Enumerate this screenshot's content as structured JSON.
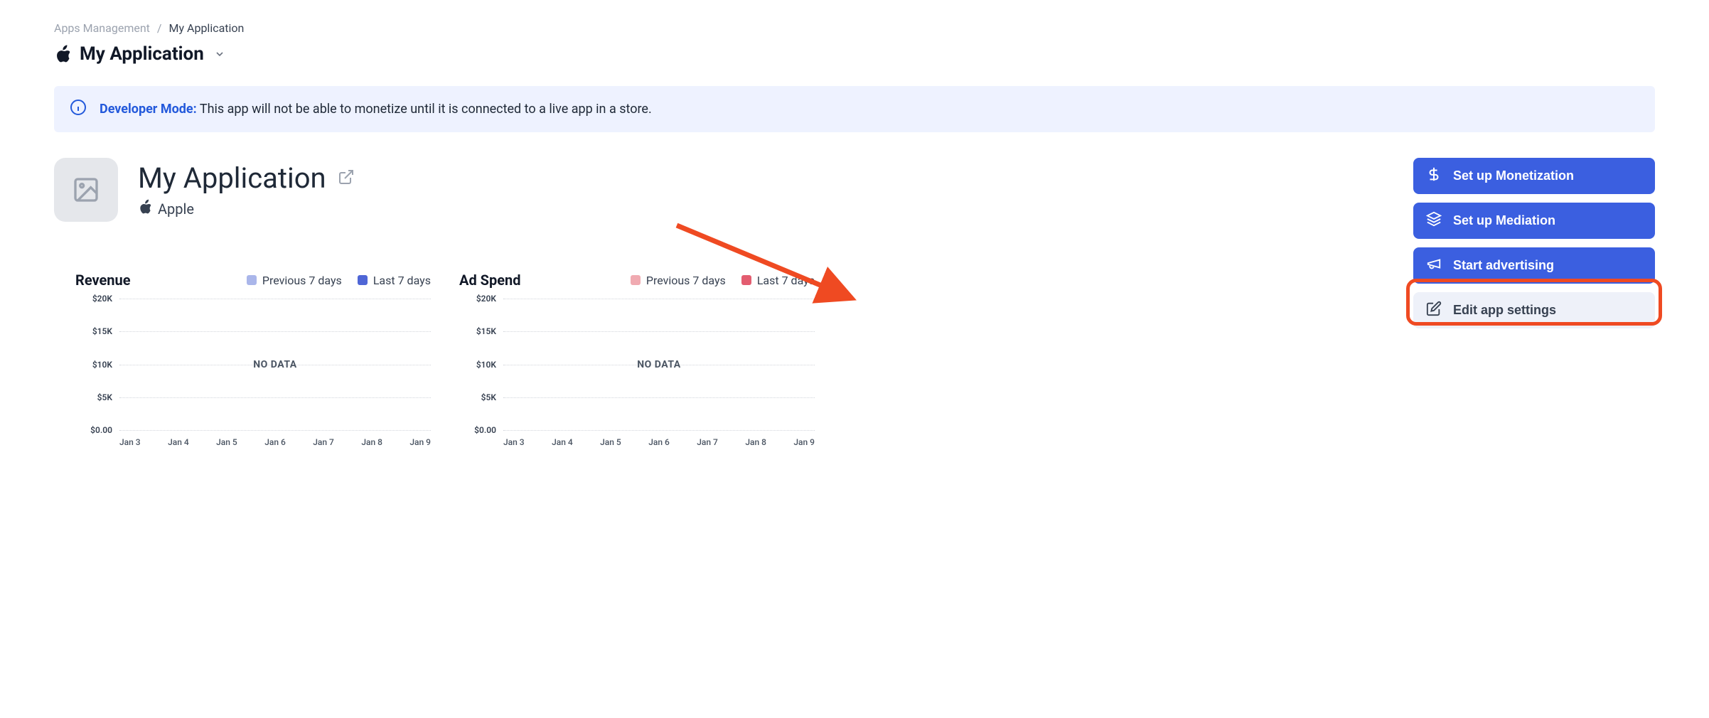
{
  "breadcrumb": {
    "root": "Apps Management",
    "current": "My Application"
  },
  "selector": {
    "app_name": "My Application"
  },
  "banner": {
    "lead": "Developer Mode:",
    "text": "This app will not be able to monetize until it is connected to a live app in a store."
  },
  "app": {
    "title": "My Application",
    "platform": "Apple"
  },
  "actions": {
    "monetization": "Set up Monetization",
    "mediation": "Set up Mediation",
    "advertising": "Start advertising",
    "edit_settings": "Edit app settings"
  },
  "legend": {
    "previous": "Previous 7 days",
    "last": "Last 7 days"
  },
  "charts": {
    "revenue": {
      "title": "Revenue",
      "no_data": "NO DATA"
    },
    "adspend": {
      "title": "Ad Spend",
      "no_data": "NO DATA"
    }
  },
  "chart_data": [
    {
      "type": "bar",
      "title": "Revenue",
      "categories": [
        "Jan 3",
        "Jan 4",
        "Jan 5",
        "Jan 6",
        "Jan 7",
        "Jan 8",
        "Jan 9"
      ],
      "series": [
        {
          "name": "Previous 7 days",
          "values": [
            null,
            null,
            null,
            null,
            null,
            null,
            null
          ]
        },
        {
          "name": "Last 7 days",
          "values": [
            null,
            null,
            null,
            null,
            null,
            null,
            null
          ]
        }
      ],
      "ylabel": "",
      "y_ticks": [
        "$20K",
        "$15K",
        "$10K",
        "$5K",
        "$0.00"
      ],
      "ylim": [
        0,
        20000
      ],
      "no_data": true
    },
    {
      "type": "bar",
      "title": "Ad Spend",
      "categories": [
        "Jan 3",
        "Jan 4",
        "Jan 5",
        "Jan 6",
        "Jan 7",
        "Jan 8",
        "Jan 9"
      ],
      "series": [
        {
          "name": "Previous 7 days",
          "values": [
            null,
            null,
            null,
            null,
            null,
            null,
            null
          ]
        },
        {
          "name": "Last 7 days",
          "values": [
            null,
            null,
            null,
            null,
            null,
            null,
            null
          ]
        }
      ],
      "ylabel": "",
      "y_ticks": [
        "$20K",
        "$15K",
        "$10K",
        "$5K",
        "$0.00"
      ],
      "ylim": [
        0,
        20000
      ],
      "no_data": true
    }
  ]
}
